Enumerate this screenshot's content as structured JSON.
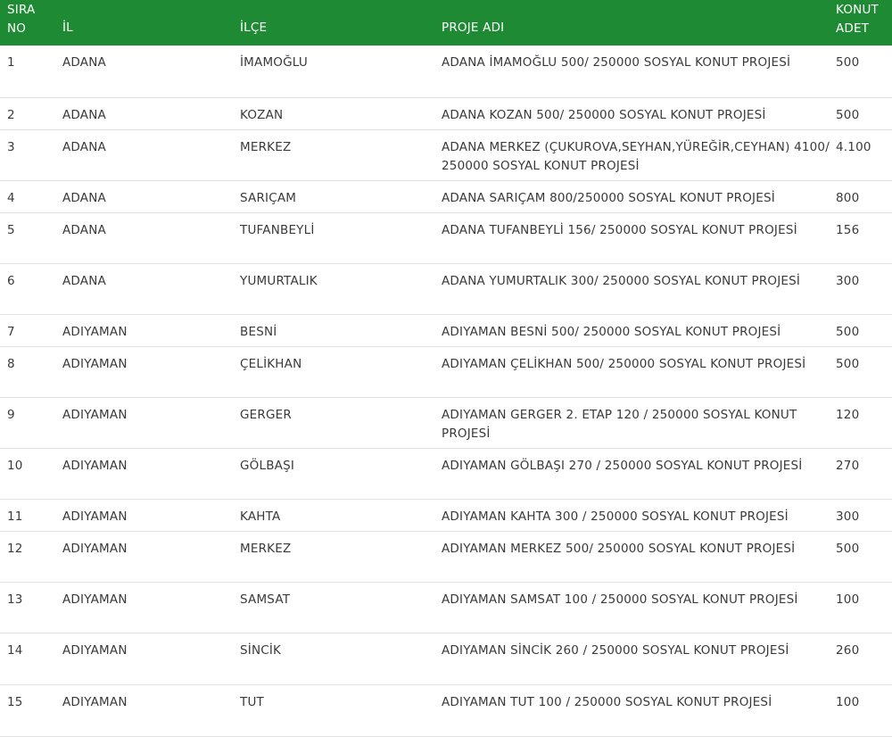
{
  "header": {
    "sira_no": "SIRA\nNO",
    "il": "İL",
    "ilce": "İLÇE",
    "proje_adi": "PROJE ADI",
    "konut_adet": "KONUT\nADET"
  },
  "rows": [
    {
      "no": "1",
      "il": "ADANA",
      "ilce": "İMAMOĞLU",
      "proje": "ADANA İMAMOĞLU 500/ 250000 SOSYAL KONUT PROJESİ",
      "adet": "500"
    },
    {
      "no": "2",
      "il": "ADANA",
      "ilce": "KOZAN",
      "proje": "ADANA KOZAN 500/ 250000 SOSYAL KONUT PROJESİ",
      "adet": "500"
    },
    {
      "no": "3",
      "il": "ADANA",
      "ilce": "MERKEZ",
      "proje": "ADANA MERKEZ (ÇUKUROVA,SEYHAN,YÜREĞİR,CEYHAN) 4100/ 250000 SOSYAL KONUT PROJESİ",
      "adet": "4.100"
    },
    {
      "no": "4",
      "il": "ADANA",
      "ilce": "SARIÇAM",
      "proje": "ADANA SARIÇAM 800/250000 SOSYAL KONUT PROJESİ",
      "adet": "800"
    },
    {
      "no": "5",
      "il": "ADANA",
      "ilce": "TUFANBEYLİ",
      "proje": "ADANA TUFANBEYLİ 156/ 250000 SOSYAL KONUT PROJESİ",
      "adet": "156"
    },
    {
      "no": "6",
      "il": "ADANA",
      "ilce": "YUMURTALIK",
      "proje": "ADANA YUMURTALIK 300/ 250000 SOSYAL KONUT PROJESİ",
      "adet": "300"
    },
    {
      "no": "7",
      "il": "ADIYAMAN",
      "ilce": "BESNİ",
      "proje": "ADIYAMAN BESNİ 500/ 250000 SOSYAL KONUT PROJESİ",
      "adet": "500"
    },
    {
      "no": "8",
      "il": "ADIYAMAN",
      "ilce": "ÇELİKHAN",
      "proje": "ADIYAMAN ÇELİKHAN 500/ 250000 SOSYAL KONUT PROJESİ",
      "adet": "500"
    },
    {
      "no": "9",
      "il": "ADIYAMAN",
      "ilce": "GERGER",
      "proje": "ADIYAMAN GERGER 2. ETAP 120 / 250000 SOSYAL KONUT PROJESİ",
      "adet": "120"
    },
    {
      "no": "10",
      "il": "ADIYAMAN",
      "ilce": "GÖLBAŞI",
      "proje": "ADIYAMAN GÖLBAŞI 270 / 250000 SOSYAL KONUT PROJESİ",
      "adet": "270"
    },
    {
      "no": "11",
      "il": "ADIYAMAN",
      "ilce": "KAHTA",
      "proje": "ADIYAMAN KAHTA 300 / 250000 SOSYAL KONUT PROJESİ",
      "adet": "300"
    },
    {
      "no": "12",
      "il": "ADIYAMAN",
      "ilce": "MERKEZ",
      "proje": "ADIYAMAN MERKEZ 500/ 250000 SOSYAL KONUT PROJESİ",
      "adet": "500"
    },
    {
      "no": "13",
      "il": "ADIYAMAN",
      "ilce": "SAMSAT",
      "proje": "ADIYAMAN SAMSAT 100 / 250000 SOSYAL KONUT PROJESİ",
      "adet": "100"
    },
    {
      "no": "14",
      "il": "ADIYAMAN",
      "ilce": "SİNCİK",
      "proje": "ADIYAMAN SİNCİK 260 / 250000 SOSYAL KONUT PROJESİ",
      "adet": "260"
    },
    {
      "no": "15",
      "il": "ADIYAMAN",
      "ilce": "TUT",
      "proje": "ADIYAMAN TUT 100 / 250000 SOSYAL KONUT PROJESİ",
      "adet": "100"
    }
  ],
  "colors": {
    "header_bg": "#1e8a33",
    "header_text": "#ffffff",
    "row_border": "#e2e2e2",
    "text": "#3a3a3a"
  }
}
